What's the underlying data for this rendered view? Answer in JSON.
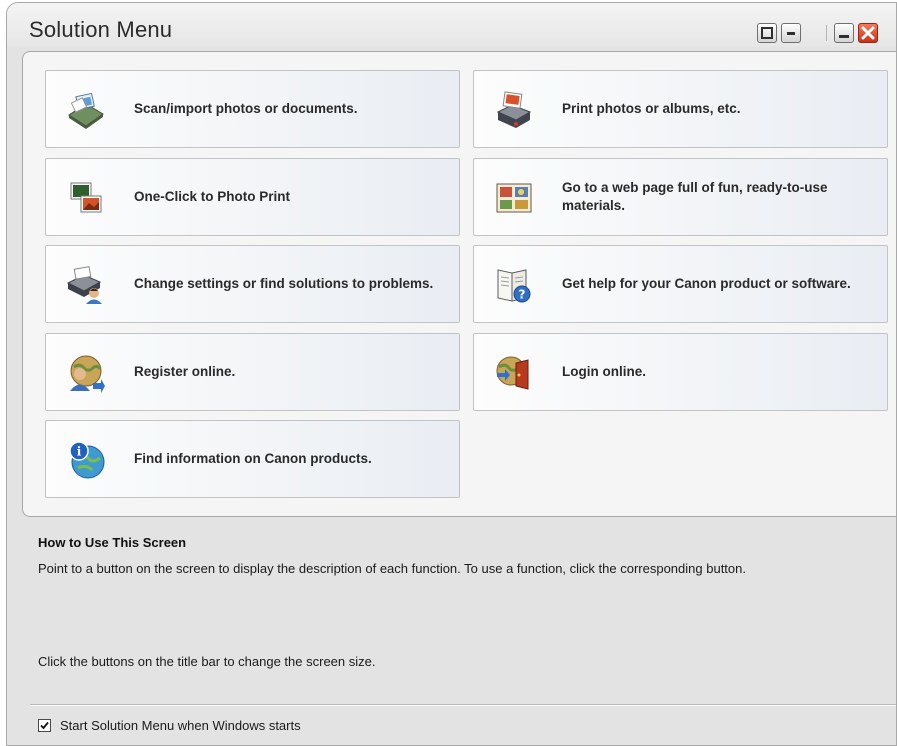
{
  "window": {
    "title": "Solution Menu"
  },
  "titlebar_buttons": [
    {
      "name": "restore-size-button",
      "icon": "window-restore-icon"
    },
    {
      "name": "reduce-size-button",
      "icon": "window-small-icon"
    },
    {
      "name": "minimize-button",
      "icon": "minimize-icon"
    },
    {
      "name": "close-button",
      "icon": "close-icon"
    }
  ],
  "tiles": [
    {
      "icon": "scanner-icon",
      "label": "Scan/import photos or documents."
    },
    {
      "icon": "printer-icon",
      "label": "Print photos or albums, etc."
    },
    {
      "icon": "photo-print-icon",
      "label": "One-Click to Photo Print"
    },
    {
      "icon": "web-materials-icon",
      "label": "Go to a web page full of fun, ready-to-use materials."
    },
    {
      "icon": "settings-printer-icon",
      "label": "Change settings or find solutions to problems."
    },
    {
      "icon": "help-manual-icon",
      "label": "Get help for your Canon product or software."
    },
    {
      "icon": "register-globe-icon",
      "label": "Register online."
    },
    {
      "icon": "login-door-icon",
      "label": "Login online."
    },
    {
      "icon": "info-globe-icon",
      "label": "Find information on Canon products."
    }
  ],
  "help": {
    "heading": "How to Use This Screen",
    "text": "Point to a button on the screen to display the description of each function. To use a function, click the corresponding button.",
    "text2": "Click the buttons on the title bar to change the screen size."
  },
  "startup": {
    "label": "Start Solution Menu when Windows starts",
    "checked": true
  },
  "colors": {
    "window_bg": "#e3e3e3",
    "panel_bg": "#f5f5f5",
    "close_red": "#d9381e"
  }
}
